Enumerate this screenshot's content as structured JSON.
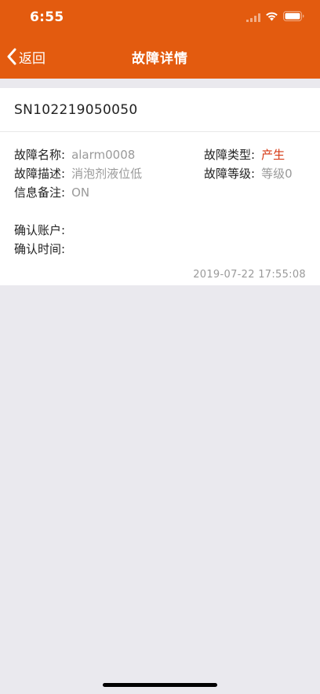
{
  "status_bar": {
    "time": "6:55"
  },
  "nav": {
    "back_label": "返回",
    "title": "故障详情"
  },
  "device": {
    "serial": "SN102219050050"
  },
  "fields": {
    "name_label": "故障名称:",
    "name_value": "alarm0008",
    "type_label": "故障类型:",
    "type_value": "产生",
    "desc_label": "故障描述:",
    "desc_value": "消泡剂液位低",
    "level_label": "故障等级:",
    "level_value": "等级0",
    "remark_label": "信息备注:",
    "remark_value": "ON",
    "account_label": "确认账户:",
    "account_value": "",
    "time_label": "确认时间:",
    "time_value": ""
  },
  "timestamp": "2019-07-22 17:55:08",
  "colors": {
    "primary": "#e35b0f",
    "type_value": "#d63a16",
    "background": "#eae9ee"
  }
}
